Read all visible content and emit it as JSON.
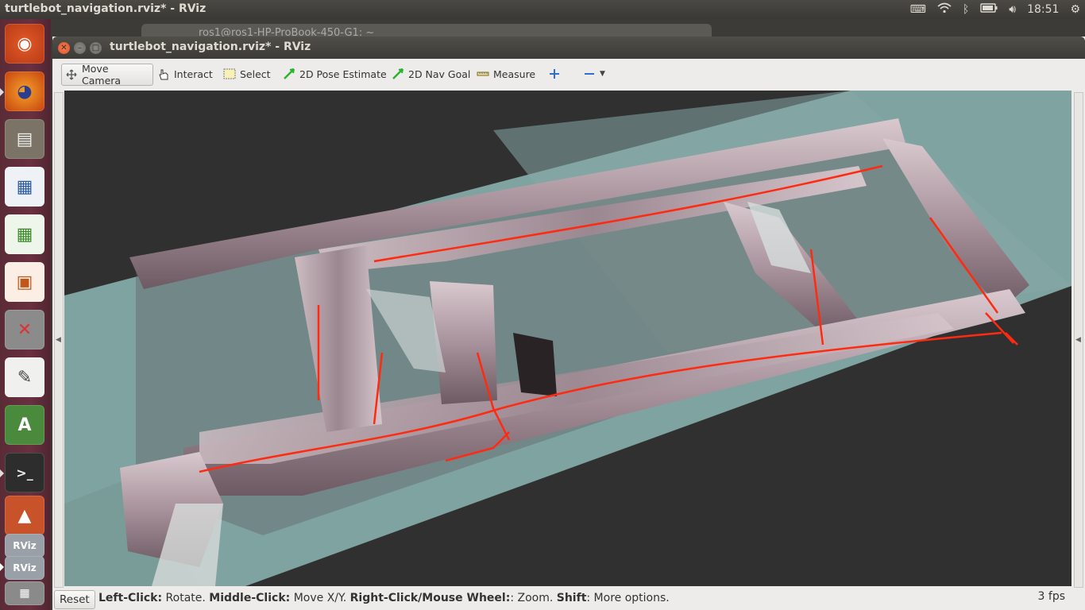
{
  "topbar": {
    "app_title": "turtlebot_navigation.rviz* - RViz",
    "time": "18:51",
    "tray_icons": [
      "keyboard-icon",
      "wifi-icon",
      "bluetooth-icon",
      "battery-icon",
      "volume-icon",
      "gear-icon"
    ]
  },
  "launcher": {
    "items": [
      "ubuntu-dash-icon",
      "firefox-icon",
      "files-icon",
      "writer-icon",
      "calc-icon",
      "impress-icon",
      "settings-icon",
      "text-editor-icon",
      "software-updater-icon",
      "terminal-icon",
      "matlab-icon",
      "rviz-icon",
      "rviz-icon",
      "workspace-icon"
    ]
  },
  "background_window": {
    "title": "ros1@ros1-HP-ProBook-450-G1: ~"
  },
  "window": {
    "title": "turtlebot_navigation.rviz* - RViz"
  },
  "toolbar": {
    "move_camera": "Move Camera",
    "interact": "Interact",
    "select": "Select",
    "pose_estimate": "2D Pose Estimate",
    "nav_goal": "2D Nav Goal",
    "measure": "Measure"
  },
  "status": {
    "reset": "Reset",
    "hint_left_bold": "Left-Click:",
    "hint_left": " Rotate. ",
    "hint_middle_bold": "Middle-Click:",
    "hint_middle": " Move X/Y. ",
    "hint_right_bold": "Right-Click/Mouse Wheel:",
    "hint_right": ": Zoom. ",
    "hint_shift_bold": "Shift",
    "hint_shift": ": More options.",
    "fps": "3 fps"
  },
  "colors": {
    "ground_plane": "#7fa3a0",
    "point_cloud": "#b8a5ae",
    "path": "#ff2a10",
    "viewport_bg": "#303030"
  }
}
